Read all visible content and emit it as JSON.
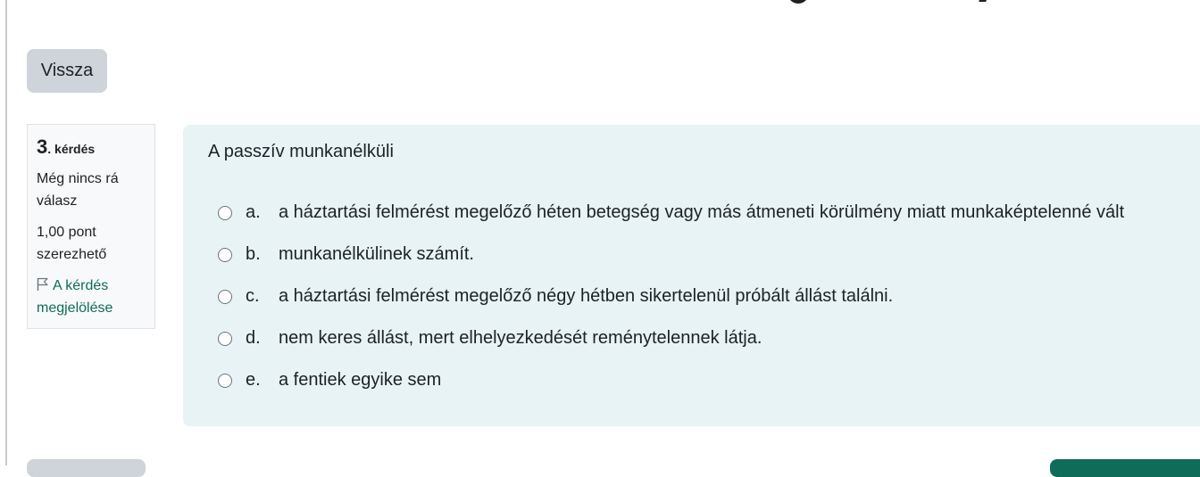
{
  "navigation": {
    "back_label": "Vissza"
  },
  "question_info": {
    "number": "3",
    "number_suffix": ". kérdés",
    "status": "Még nincs rá válasz",
    "points": "1,00 pont szerezhető",
    "flag_label": "A kérdés megjelölése"
  },
  "question": {
    "text": "A passzív munkanélküli",
    "answers": [
      {
        "letter": "a.",
        "text": "a háztartási felmérést megelőző héten betegség vagy más átmeneti körülmény miatt munkaképtelenné vált"
      },
      {
        "letter": "b.",
        "text": "munkanélkülinek számít."
      },
      {
        "letter": "c.",
        "text": "a háztartási felmérést megelőző négy hétben sikertelenül próbált állást találni."
      },
      {
        "letter": "d.",
        "text": "nem keres állást, mert elhelyezkedését reménytelennek látja."
      },
      {
        "letter": "e.",
        "text": "a fentiek egyike sem"
      }
    ]
  },
  "colors": {
    "question_background": "#e7f3f5",
    "link_green": "#0f6c58",
    "button_gray": "#ced4da"
  },
  "icons": {
    "flag": "flag-icon",
    "radio": "radio-unchecked-icon"
  }
}
